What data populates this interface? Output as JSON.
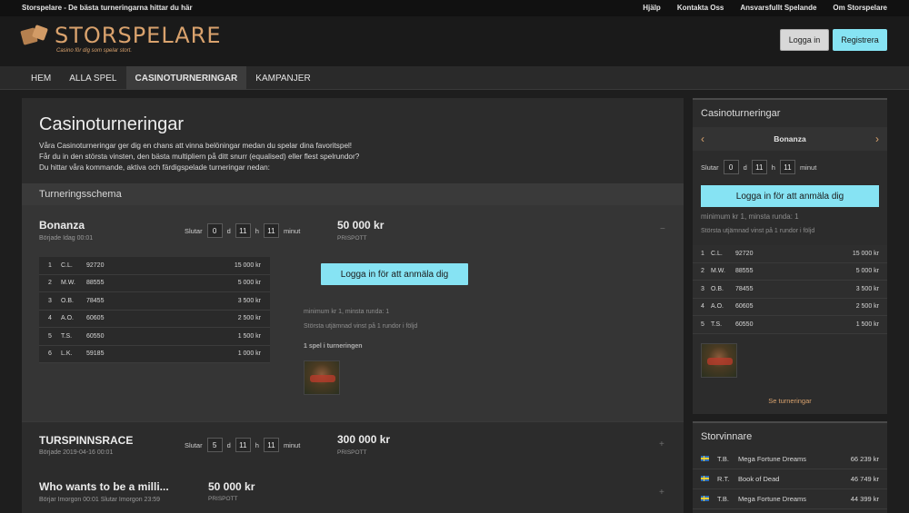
{
  "topbar": {
    "tagline": "Storspelare - De bästa turneringarna hittar du här",
    "links": [
      "Hjälp",
      "Kontakta Oss",
      "Ansvarsfullt Spelande",
      "Om Storspelare"
    ]
  },
  "header": {
    "logo_text": "STORSPELARE",
    "logo_sub": "Casino för dig som spelar stort.",
    "login_label": "Logga in",
    "register_label": "Registrera"
  },
  "nav": [
    "HEM",
    "ALLA SPEL",
    "CASINOTURNERINGAR",
    "KAMPANJER"
  ],
  "main": {
    "title": "Casinoturneringar",
    "intro": [
      "Våra Casinoturneringar ger dig en chans att vinna belöningar medan du spelar dina favoritspel!",
      "Får du in den största vinsten, den bästa multipliern på ditt snurr (equalised) eller flest spelrundor?",
      "Du hittar våra kommande, aktiva och färdigspelade turneringar nedan:"
    ],
    "section": "Turneringsschema",
    "timer_labels": {
      "ends": "Slutar",
      "d": "d",
      "h": "h",
      "m": "minut"
    },
    "tournaments": [
      {
        "name": "Bonanza",
        "sub": "Började Idag 00:01",
        "days": "0",
        "hours": "11",
        "minutes": "11",
        "prize": "50 000 kr",
        "prize_label": "PRISPOTT",
        "toggle": "−",
        "join_label": "Logga in för att anmäla dig",
        "note_min": "minimum kr 1, minsta runda: 1",
        "note_rule": "Största utjämnad vinst på 1 rundor i följd",
        "games_label": "1 spel i turneringen",
        "leaderboard": [
          {
            "rank": "1",
            "name": "C.L.",
            "score": "92720",
            "amount": "15 000 kr"
          },
          {
            "rank": "2",
            "name": "M.W.",
            "score": "88555",
            "amount": "5 000 kr"
          },
          {
            "rank": "3",
            "name": "O.B.",
            "score": "78455",
            "amount": "3 500 kr"
          },
          {
            "rank": "4",
            "name": "A.O.",
            "score": "60605",
            "amount": "2 500 kr"
          },
          {
            "rank": "5",
            "name": "T.S.",
            "score": "60550",
            "amount": "1 500 kr"
          },
          {
            "rank": "6",
            "name": "L.K.",
            "score": "59185",
            "amount": "1 000 kr"
          }
        ]
      },
      {
        "name": "TURSPINNSRACE",
        "sub": "Började 2019-04-16 00:01",
        "days": "5",
        "hours": "11",
        "minutes": "11",
        "prize": "300 000 kr",
        "prize_label": "PRISPOTT",
        "toggle": "+"
      },
      {
        "name": "Who wants to be a milli...",
        "sub": "Börjar Imorgon 00:01 Slutar Imorgon 23:59",
        "prize": "50 000 kr",
        "prize_label": "PRISPOTT",
        "toggle": "+"
      }
    ]
  },
  "sidebar": {
    "title": "Casinoturneringar",
    "current": "Bonanza",
    "prev_arrow": "‹",
    "next_arrow": "›",
    "days": "0",
    "hours": "11",
    "minutes": "11",
    "join_label": "Logga in för att anmäla dig",
    "note_min": "minimum kr 1, minsta runda: 1",
    "note_rule": "Största utjämnad vinst på 1 rundor i följd",
    "leaderboard": [
      {
        "rank": "1",
        "name": "C.L.",
        "score": "92720",
        "amount": "15 000 kr"
      },
      {
        "rank": "2",
        "name": "M.W.",
        "score": "88555",
        "amount": "5 000 kr"
      },
      {
        "rank": "3",
        "name": "O.B.",
        "score": "78455",
        "amount": "3 500 kr"
      },
      {
        "rank": "4",
        "name": "A.O.",
        "score": "60605",
        "amount": "2 500 kr"
      },
      {
        "rank": "5",
        "name": "T.S.",
        "score": "60550",
        "amount": "1 500 kr"
      }
    ],
    "see_all": "Se turneringar"
  },
  "winners": {
    "title": "Storvinnare",
    "items": [
      {
        "name": "T.B.",
        "game": "Mega Fortune Dreams",
        "amount": "66 239 kr"
      },
      {
        "name": "R.T.",
        "game": "Book of Dead",
        "amount": "46 749 kr"
      },
      {
        "name": "T.B.",
        "game": "Mega Fortune Dreams",
        "amount": "44 399 kr"
      }
    ]
  },
  "colors": {
    "accent": "#86e3f3",
    "brand": "#d9a26d",
    "background": "#1e1e1e"
  }
}
